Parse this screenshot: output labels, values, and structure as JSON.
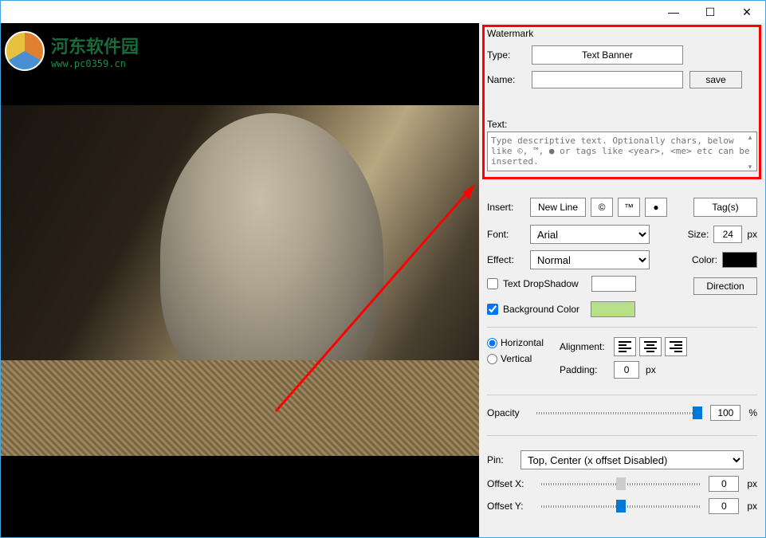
{
  "logo": {
    "cn_text": "河东软件园",
    "url_text": "www.pc0359.cn"
  },
  "titlebar": {
    "minimize": "—",
    "maximize": "☐",
    "close": "✕"
  },
  "watermark": {
    "section_title": "Watermark",
    "type_label": "Type:",
    "type_value": "Text Banner",
    "name_label": "Name:",
    "name_value": "",
    "save_label": "save",
    "text_label": "Text:",
    "text_placeholder": "Type descriptive text. Optionally chars, below like ©, ™, ● or tags like <year>, <me> etc can be inserted."
  },
  "insert": {
    "label": "Insert:",
    "newline": "New Line",
    "copyright": "©",
    "trademark": "™",
    "bullet": "●",
    "tags": "Tag(s)"
  },
  "font": {
    "label": "Font:",
    "value": "Arial",
    "size_label": "Size:",
    "size_value": "24",
    "size_unit": "px"
  },
  "effect": {
    "label": "Effect:",
    "value": "Normal",
    "color_label": "Color:"
  },
  "dropshadow": {
    "label": "Text DropShadow",
    "checked": false,
    "direction_label": "Direction"
  },
  "bgcolor": {
    "label": "Background Color",
    "checked": true
  },
  "orientation": {
    "horizontal": "Horizontal",
    "vertical": "Vertical",
    "selected": "horizontal"
  },
  "alignment": {
    "label": "Alignment:",
    "padding_label": "Padding:",
    "padding_value": "0",
    "padding_unit": "px"
  },
  "opacity": {
    "label": "Opacity",
    "value": "100",
    "unit": "%"
  },
  "pin": {
    "label": "Pin:",
    "value": "Top, Center (x offset Disabled)"
  },
  "offset": {
    "x_label": "Offset X:",
    "x_value": "0",
    "x_unit": "px",
    "y_label": "Offset Y:",
    "y_value": "0",
    "y_unit": "px"
  }
}
